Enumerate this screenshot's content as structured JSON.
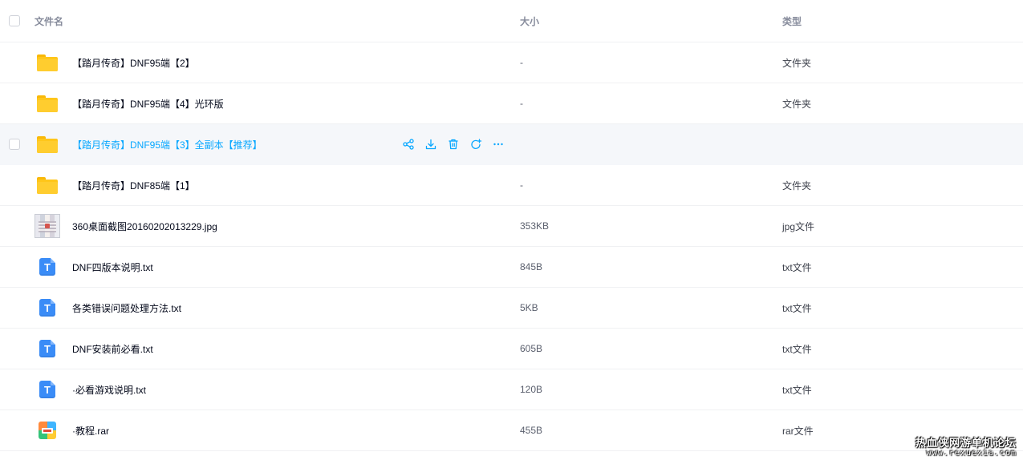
{
  "header": {
    "name": "文件名",
    "size": "大小",
    "type": "类型"
  },
  "rows": [
    {
      "icon": "folder-icon",
      "name": "【踏月传奇】DNF95端【2】",
      "size": "-",
      "type": "文件夹"
    },
    {
      "icon": "folder-icon",
      "name": "【踏月传奇】DNF95端【4】光环版",
      "size": "-",
      "type": "文件夹"
    },
    {
      "icon": "folder-icon",
      "name": "【踏月传奇】DNF95端【3】全副本【推荐】",
      "size": "",
      "type": "",
      "hovered": true
    },
    {
      "icon": "folder-icon",
      "name": "【踏月传奇】DNF85端【1】",
      "size": "-",
      "type": "文件夹"
    },
    {
      "icon": "image-thumbnail",
      "name": "360桌面截图20160202013229.jpg",
      "size": "353KB",
      "type": "jpg文件"
    },
    {
      "icon": "txt-file-icon",
      "name": "DNF四版本说明.txt",
      "size": "845B",
      "type": "txt文件"
    },
    {
      "icon": "txt-file-icon",
      "name": "各类错误问题处理方法.txt",
      "size": "5KB",
      "type": "txt文件"
    },
    {
      "icon": "txt-file-icon",
      "name": "DNF安装前必看.txt",
      "size": "605B",
      "type": "txt文件"
    },
    {
      "icon": "txt-file-icon",
      "name": "·必看游戏说明.txt",
      "size": "120B",
      "type": "txt文件"
    },
    {
      "icon": "rar-file-icon",
      "name": "·教程.rar",
      "size": "455B",
      "type": "rar文件"
    }
  ],
  "hover_actions": [
    "share-icon",
    "download-icon",
    "delete-icon",
    "refresh-icon",
    "more-icon"
  ],
  "icons": {
    "txt_letter": "T"
  },
  "colors": {
    "accent": "#06a7ff",
    "folder": "#ffc61a",
    "txt": "#3a8cf7"
  },
  "watermark": {
    "line1": "热血侠网游单机论坛",
    "line2": "www.rexuexia.com"
  }
}
